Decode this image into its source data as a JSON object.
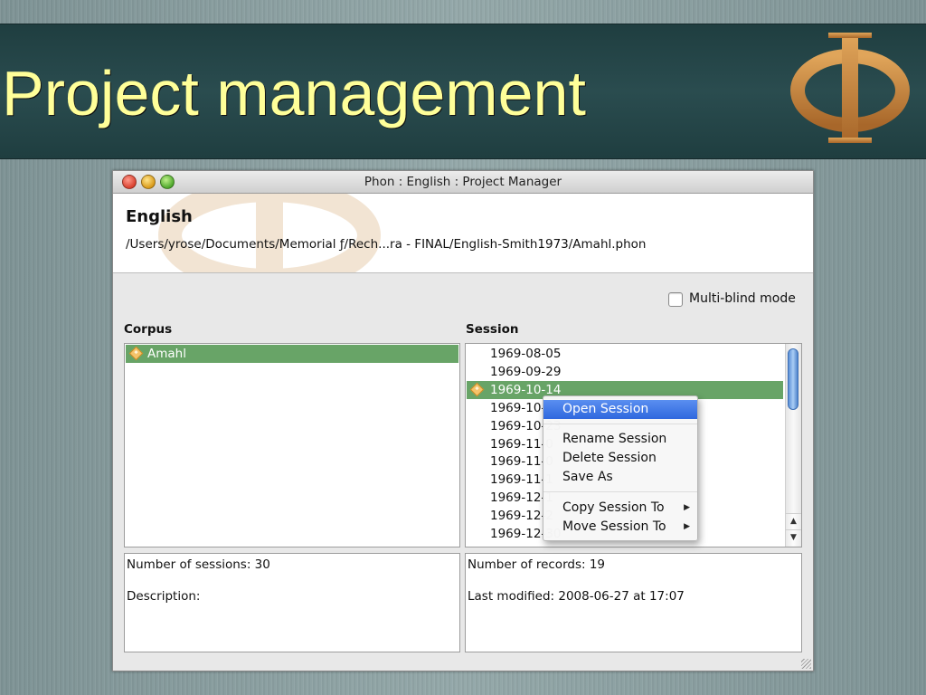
{
  "slide": {
    "title": "Project management"
  },
  "window": {
    "title": "Phon : English : Project Manager"
  },
  "project": {
    "name": "English",
    "path": "/Users/yrose/Documents/Memorial ƒ/Rech...ra - FINAL/English-Smith1973/Amahl.phon"
  },
  "options": {
    "multi_blind_label": "Multi-blind mode",
    "multi_blind_checked": false
  },
  "corpus": {
    "label": "Corpus",
    "items": [
      "Amahl"
    ],
    "selected_index": 0
  },
  "session": {
    "label": "Session",
    "items": [
      "1969-08-05",
      "1969-09-29",
      "1969-10-14",
      "1969-10-1",
      "1969-10-23",
      "1969-11-0",
      "1969-11-0",
      "1969-11-1",
      "1969-12-1",
      "1969-12-2",
      "1969-12-30"
    ],
    "selected_index": 2
  },
  "corpus_info": {
    "sessions_line": "Number of sessions: 30",
    "description_line": "Description:"
  },
  "session_info": {
    "records_line": "Number of records: 19",
    "modified_line": "Last modified: 2008-06-27 at 17:07"
  },
  "context_menu": {
    "items": [
      {
        "label": "Open Session",
        "highlighted": true,
        "submenu": false
      },
      {
        "label": "Rename Session",
        "highlighted": false,
        "submenu": false
      },
      {
        "label": "Delete Session",
        "highlighted": false,
        "submenu": false
      },
      {
        "label": "Save As",
        "highlighted": false,
        "submenu": false
      },
      {
        "label": "Copy Session To",
        "highlighted": false,
        "submenu": true
      },
      {
        "label": "Move Session To",
        "highlighted": false,
        "submenu": true
      }
    ]
  },
  "colors": {
    "title": "#ffff99",
    "selection": "#68a467",
    "menu_highlight": "#2f67de",
    "logo": "#c98a3c"
  },
  "icons": {
    "logo": "phi-symbol-icon",
    "session_marker": "diamond-icon",
    "submenu": "triangle-right-icon"
  }
}
